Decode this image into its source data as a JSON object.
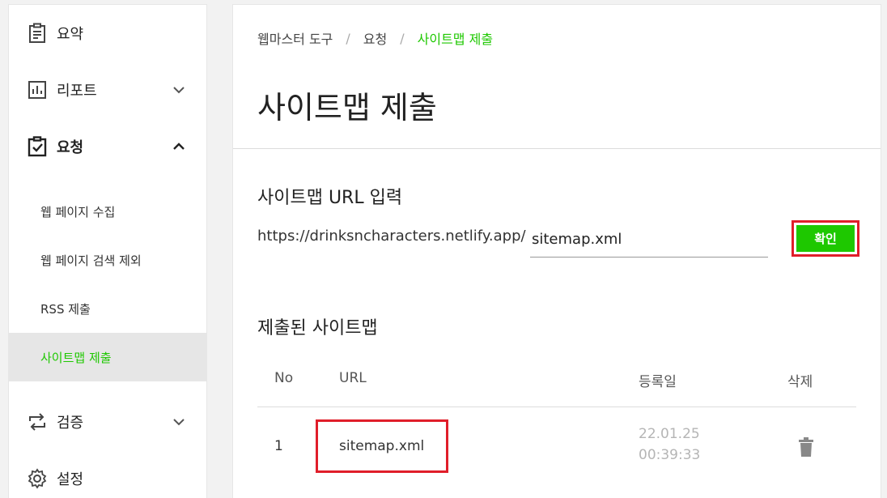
{
  "sidebar": {
    "items": [
      {
        "label": "요약"
      },
      {
        "label": "리포트"
      },
      {
        "label": "요청"
      },
      {
        "label": "검증"
      },
      {
        "label": "설정"
      }
    ],
    "sub_items": [
      {
        "label": "웹 페이지 수집"
      },
      {
        "label": "웹 페이지 검색 제외"
      },
      {
        "label": "RSS 제출"
      },
      {
        "label": "사이트맵 제출"
      }
    ]
  },
  "breadcrumb": {
    "items": [
      "웹마스터 도구",
      "요청",
      "사이트맵 제출"
    ],
    "separator": "/"
  },
  "page": {
    "title": "사이트맵 제출"
  },
  "form": {
    "section_title": "사이트맵 URL 입력",
    "url_prefix": "https://drinksncharacters.netlify.app/",
    "input_value": "sitemap.xml",
    "confirm_label": "확인"
  },
  "submitted": {
    "section_title": "제출된 사이트맵",
    "headers": [
      "No",
      "URL",
      "등록일",
      "삭제"
    ],
    "rows": [
      {
        "no": "1",
        "url": "sitemap.xml",
        "date": "22.01.25 00:39:33"
      }
    ]
  },
  "colors": {
    "accent": "#1ec800",
    "highlight": "#e01e2a",
    "muted": "#b5b5b5"
  }
}
